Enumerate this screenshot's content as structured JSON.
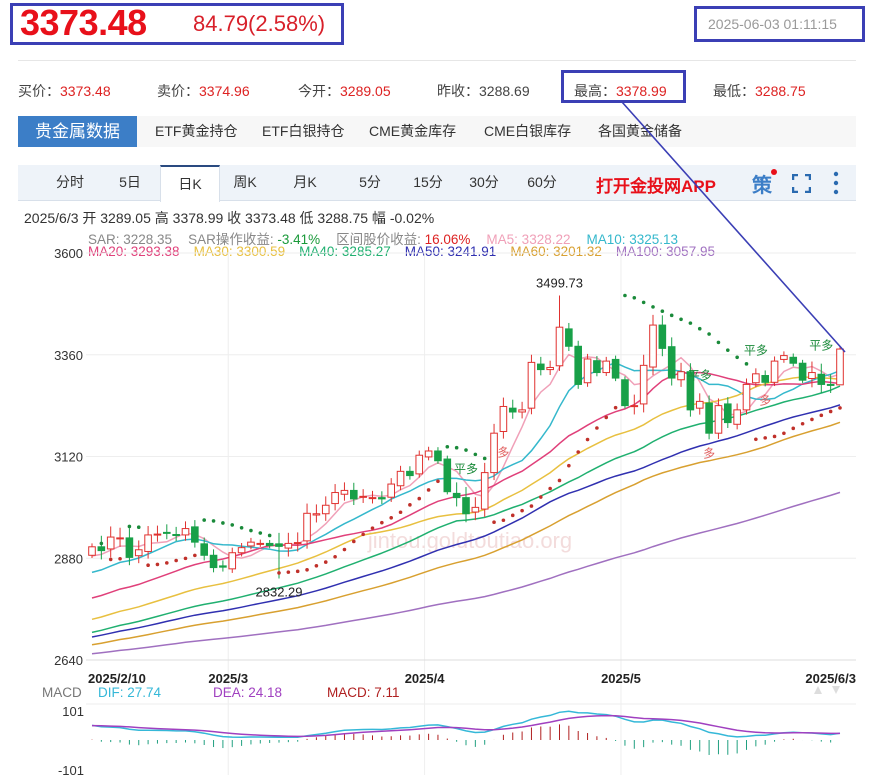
{
  "header": {
    "price": "3373.48",
    "change": "84.79(2.58%)",
    "time": "2025-06-03 01:11:15"
  },
  "stats": [
    {
      "label": "买价：",
      "value": "3373.48"
    },
    {
      "label": "卖价：",
      "value": "3374.96"
    },
    {
      "label": "今开：",
      "value": "3289.05"
    },
    {
      "label": "昨收：",
      "value": "3288.69"
    },
    {
      "label": "最高：",
      "value": "3378.99"
    },
    {
      "label": "最低：",
      "value": "3288.75"
    }
  ],
  "data_tabs": [
    "贵金属数据",
    "ETF黄金持仓",
    "ETF白银持仓",
    "CME黄金库存",
    "CME白银库存",
    "各国黄金储备"
  ],
  "period_tabs": [
    "分时",
    "5日",
    "日K",
    "周K",
    "月K",
    "5分",
    "15分",
    "30分",
    "60分"
  ],
  "active_period": "日K",
  "app_link": "打开金投网APP",
  "strategy_icon": "策",
  "info": "2025/6/3  开 3289.05  高 3378.99  收 3373.48  低 3288.75  幅 -0.02%",
  "legend1": [
    {
      "text": "SAR: 3228.35",
      "color": "#888"
    },
    {
      "text": "SAR操作收益: ",
      "color": "#888"
    },
    {
      "text": "-3.41%",
      "color": "#1a9a3a"
    },
    {
      "text": "区间股价收益: ",
      "color": "#888"
    },
    {
      "text": "16.06%",
      "color": "#d22"
    },
    {
      "text": "MA5: 3328.22",
      "color": "#f0a0b8"
    },
    {
      "text": "MA10: 3325.13",
      "color": "#35b8cc"
    }
  ],
  "legend2": [
    {
      "text": "MA20: 3293.38",
      "color": "#e0407a"
    },
    {
      "text": "MA30: 3300.59",
      "color": "#e8c040"
    },
    {
      "text": "MA40: 3285.27",
      "color": "#20b070"
    },
    {
      "text": "MA50: 3241.91",
      "color": "#3030b0"
    },
    {
      "text": "MA60: 3201.32",
      "color": "#d8a030"
    },
    {
      "text": "MA100: 3057.95",
      "color": "#a070c0"
    }
  ],
  "chart_data": {
    "type": "candlestick",
    "y_ticks": [
      "3600",
      "3360",
      "3120",
      "2880",
      "2640"
    ],
    "ylim": [
      2640,
      3600
    ],
    "x_labels": [
      "2025/2/10",
      "2025/3",
      "2025/4",
      "2025/5",
      "2025/6/3"
    ],
    "x_label_index": [
      0,
      15,
      36,
      57,
      80
    ],
    "closes": [
      2907,
      2898,
      2930,
      2928,
      2882,
      2900,
      2935,
      2937,
      2940,
      2935,
      2950,
      2918,
      2887,
      2858,
      2859,
      2893,
      2905,
      2918,
      2915,
      2910,
      2908,
      2915,
      2917,
      2986,
      2985,
      3005,
      3035,
      3040,
      3020,
      3026,
      3023,
      3020,
      3055,
      3085,
      3075,
      3123,
      3133,
      3110,
      3037,
      3023,
      2985,
      3000,
      3082,
      3175,
      3238,
      3225,
      3230,
      3342,
      3325,
      3330,
      3425,
      3380,
      3290,
      3350,
      3318,
      3345,
      3305,
      3240,
      3240,
      3335,
      3430,
      3375,
      3305,
      3320,
      3230,
      3250,
      3175,
      3240,
      3200,
      3230,
      3290,
      3315,
      3295,
      3345,
      3358,
      3340,
      3300,
      3318,
      3290,
      3289,
      3373.48
    ],
    "last_candle": {
      "open": 3289.05,
      "high": 3378.99,
      "low": 3288.75,
      "close": 3373.48
    },
    "max_label": "3499.73",
    "min_label": "2832.29",
    "ma": [
      {
        "n": 5,
        "color": "#f0a0b8",
        "start": 2880
      },
      {
        "n": 10,
        "color": "#35b8cc",
        "start": 2840
      },
      {
        "n": 20,
        "color": "#e0407a",
        "start": 2780
      },
      {
        "n": 30,
        "color": "#e8c040",
        "start": 2730
      },
      {
        "n": 40,
        "color": "#20b070",
        "start": 2700
      },
      {
        "n": 50,
        "color": "#3030b0",
        "start": 2690
      },
      {
        "n": 60,
        "color": "#d8a030",
        "start": 2672
      },
      {
        "n": 100,
        "color": "#a070c0",
        "start": 2652
      }
    ],
    "signals": [
      {
        "i": 40,
        "text": "平多"
      },
      {
        "i": 44,
        "text": "多"
      },
      {
        "i": 65,
        "text": "平多"
      },
      {
        "i": 66,
        "text": "多"
      },
      {
        "i": 71,
        "text": "平多"
      },
      {
        "i": 72,
        "text": "多"
      },
      {
        "i": 78,
        "text": "平多"
      }
    ],
    "macd": {
      "label": "MACD",
      "dif": "DIF: 27.74",
      "dea": "DEA: 24.18",
      "macd": "MACD: 7.11",
      "ticks": [
        "101",
        "-101"
      ],
      "range": [
        -101,
        101
      ]
    },
    "colors": {
      "up": "#e0312f",
      "down": "#18a048",
      "dif": "#35b8d8",
      "dea": "#a040c0",
      "sar": "#1a8a3a"
    }
  },
  "watermark": "jintou.goldtoutiao.org"
}
